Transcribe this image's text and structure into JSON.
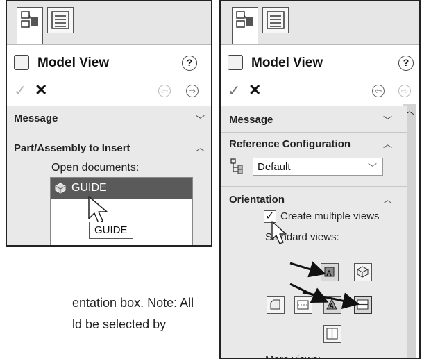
{
  "left_panel": {
    "title": "Model View",
    "help_label": "?",
    "sections": {
      "message": "Message",
      "part_assembly": "Part/Assembly to Insert"
    },
    "open_documents_label": "Open documents:",
    "documents": [
      {
        "name": "GUIDE",
        "selected": true
      }
    ],
    "tooltip": "GUIDE"
  },
  "right_panel": {
    "title": "Model View",
    "help_label": "?",
    "sections": {
      "message": "Message",
      "reference_configuration": "Reference Configuration",
      "orientation": "Orientation"
    },
    "configuration_value": "Default",
    "create_multiple_views_label": "Create multiple views",
    "create_multiple_views_checked": true,
    "standard_views_label": "Standard views:",
    "more_views_label": "More views:"
  },
  "caption": {
    "line1": "entation box. Note: All",
    "line2": "ld be selected by"
  },
  "colors": {
    "selected_row": "#5a5a5a",
    "section_bg": "#e9e9e9",
    "scrollbar": "#d3d3d3"
  }
}
